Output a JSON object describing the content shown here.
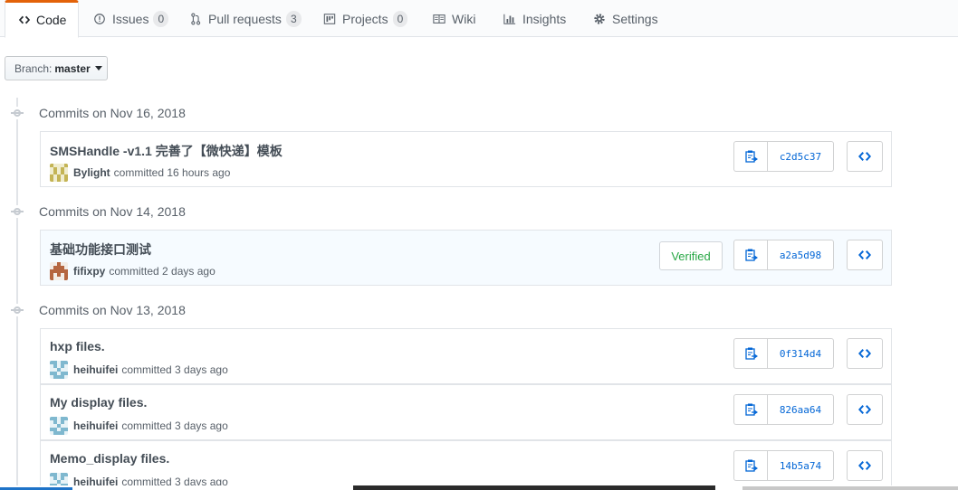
{
  "tabs": [
    {
      "label": "Code",
      "icon": "code-icon",
      "selected": true
    },
    {
      "label": "Issues",
      "icon": "issue-opened-icon",
      "count": "0"
    },
    {
      "label": "Pull requests",
      "icon": "git-pull-request-icon",
      "count": "3"
    },
    {
      "label": "Projects",
      "icon": "project-icon",
      "count": "0"
    },
    {
      "label": "Wiki",
      "icon": "book-icon"
    },
    {
      "label": "Insights",
      "icon": "graph-icon"
    },
    {
      "label": "Settings",
      "icon": "gear-icon"
    }
  ],
  "branch": {
    "prefix": "Branch:",
    "name": "master"
  },
  "groups": [
    {
      "date": "Commits on Nov 16, 2018",
      "commits": [
        {
          "message": "SMSHandle -v1.1 完善了【微快递】模板",
          "author": "Bylight",
          "time": "committed 16 hours ago",
          "sha": "c2d5c37",
          "verified": false
        }
      ]
    },
    {
      "date": "Commits on Nov 14, 2018",
      "commits": [
        {
          "message": "基础功能接口测试",
          "author": "fifixpy",
          "time": "committed 2 days ago",
          "sha": "a2a5d98",
          "verified": true,
          "verified_label": "Verified"
        }
      ]
    },
    {
      "date": "Commits on Nov 13, 2018",
      "commits": [
        {
          "message": "hxp files.",
          "author": "heihuifei",
          "time": "committed 3 days ago",
          "sha": "0f314d4",
          "verified": false
        },
        {
          "message": "My display files.",
          "author": "heihuifei",
          "time": "committed 3 days ago",
          "sha": "826aa64",
          "verified": false
        },
        {
          "message": "Memo_display files.",
          "author": "heihuifei",
          "time": "committed 3 days ago",
          "sha": "14b5a74",
          "verified": false
        }
      ]
    }
  ],
  "colors": {
    "accent_tab": "#e36209",
    "link": "#0366d6",
    "verified": "#28a745"
  }
}
